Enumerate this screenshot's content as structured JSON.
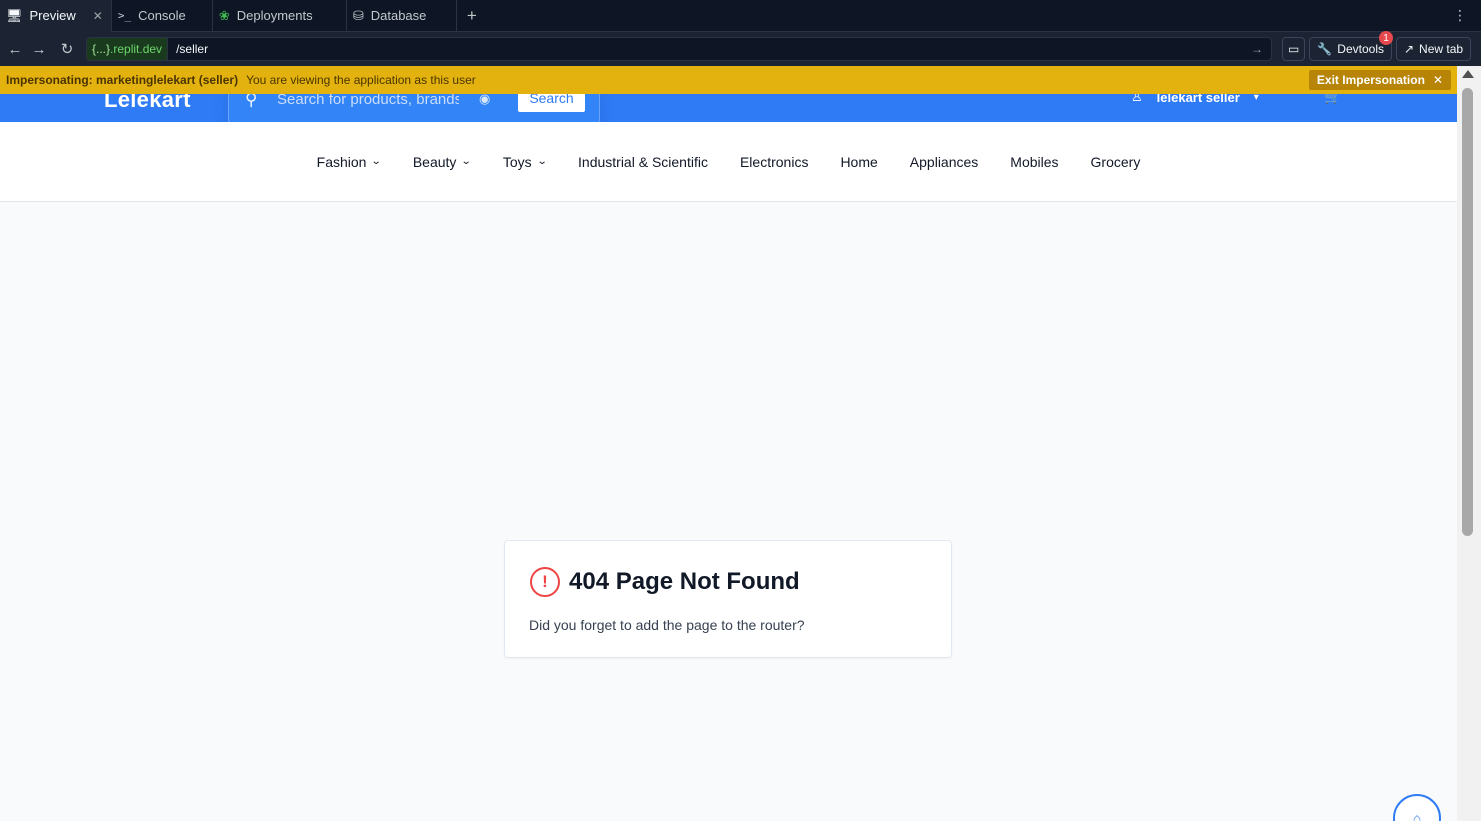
{
  "tabs": [
    {
      "label": "Preview",
      "icon": "monitor-icon",
      "active": true
    },
    {
      "label": "Console",
      "icon": "terminal-icon"
    },
    {
      "label": "Deployments",
      "icon": "deploy-icon"
    },
    {
      "label": "Database",
      "icon": "database-icon"
    }
  ],
  "address": {
    "domain_brace": "{...}",
    "domain": ".replit.dev",
    "path": "/seller",
    "devtools_label": "Devtools",
    "devtools_badge": "1",
    "newtab_label": "New tab"
  },
  "banner": {
    "who": "Impersonating: marketinglelekart (seller)",
    "message": "You are viewing the application as this user",
    "exit_label": "Exit Impersonation"
  },
  "site": {
    "logo": "Lelekart",
    "search_placeholder": "Search for products, brands",
    "search_button": "Search",
    "user_label": "lelekart seller"
  },
  "categories": [
    {
      "label": "Fashion",
      "dropdown": true
    },
    {
      "label": "Beauty",
      "dropdown": true
    },
    {
      "label": "Toys",
      "dropdown": true
    },
    {
      "label": "Industrial & Scientific",
      "dropdown": false
    },
    {
      "label": "Electronics",
      "dropdown": false
    },
    {
      "label": "Home",
      "dropdown": false
    },
    {
      "label": "Appliances",
      "dropdown": false
    },
    {
      "label": "Mobiles",
      "dropdown": false
    },
    {
      "label": "Grocery",
      "dropdown": false
    }
  ],
  "notfound": {
    "title": "404 Page Not Found",
    "message": "Did you forget to add the page to the router?"
  },
  "colors": {
    "header_blue": "#2f7bf5",
    "banner_yellow": "#e4b20f",
    "alert_red": "#ef4444"
  }
}
